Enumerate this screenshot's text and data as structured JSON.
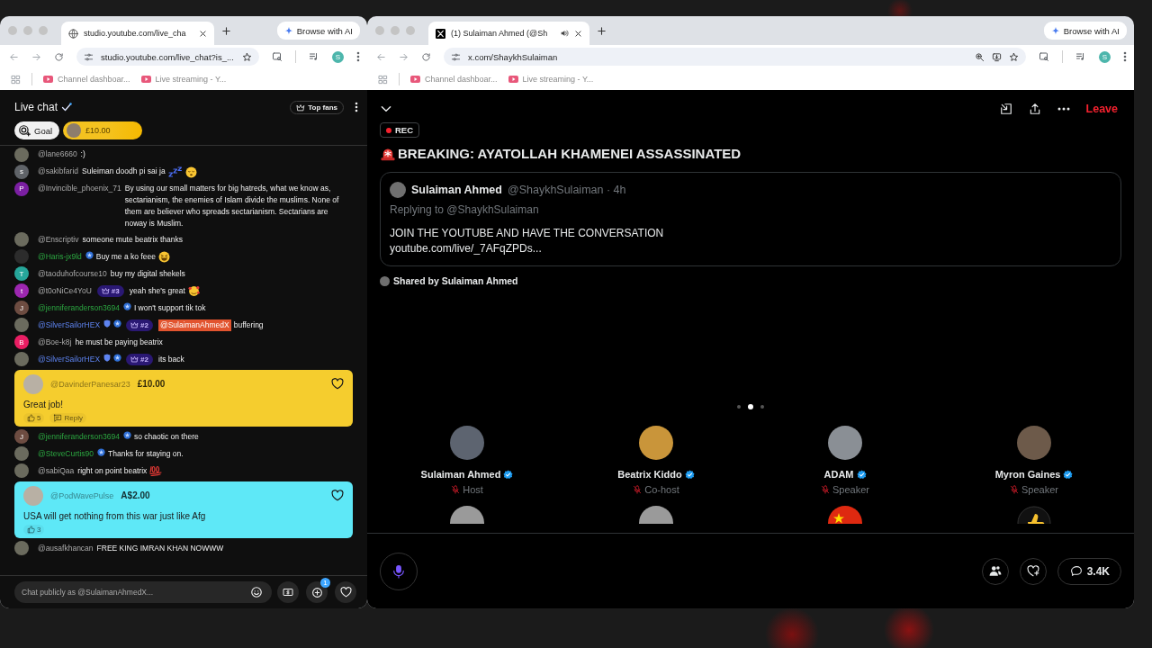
{
  "windows": [
    {
      "kind": "youtube-chat",
      "tab": {
        "icon": {
          "kind": "globe"
        },
        "title": "studio.youtube.com/live_cha"
      },
      "browse_ai": "Browse with AI",
      "address": "studio.youtube.com/live_chat?is_...",
      "profile": "S",
      "bookmarks": [
        {
          "label": "Channel dashboar..."
        },
        {
          "label": "Live streaming - Y..."
        }
      ],
      "chat": {
        "title": "Live chat",
        "top_fans": "Top fans",
        "goal": "Goal",
        "pinned_amount": "£10.00",
        "messages": [
          {
            "kind": "text",
            "avatar": {
              "kind": "photo"
            },
            "author": {
              "name": "@lane6660",
              "kind": "viewer"
            },
            "text": ":)"
          },
          {
            "kind": "text",
            "avatar": {
              "kind": "letter",
              "letter": "s",
              "color": "#5f6368"
            },
            "author": {
              "name": "@sakibfarid",
              "kind": "viewer"
            },
            "text": "Suleiman doodh pi sai ja",
            "emoji": [
              {
                "kind": "zzz"
              },
              {
                "kind": "sleeping-face"
              }
            ]
          },
          {
            "kind": "text",
            "avatar": {
              "kind": "letter",
              "letter": "P",
              "color": "#7b1fa2"
            },
            "author": {
              "name": "@Invincible_phoenix_71",
              "kind": "viewer"
            },
            "text": "By using our small matters for big hatreds, what we know as, sectarianism, the enemies of Islam divide the muslims. None of them are believer who spreads sectarianism. Sectarians are noway is Muslim."
          },
          {
            "kind": "text",
            "avatar": {
              "kind": "photo"
            },
            "author": {
              "name": "@Enscriptiv",
              "kind": "viewer"
            },
            "text": "someone mute beatrix thanks"
          },
          {
            "kind": "text",
            "avatar": {
              "kind": "blank"
            },
            "author": {
              "name": "@Haris-jx9ld",
              "kind": "member"
            },
            "badges": [
              {
                "kind": "member"
              }
            ],
            "text": "Buy me a ko feee",
            "emoji": [
              {
                "kind": "rolling-laughing"
              }
            ]
          },
          {
            "kind": "text",
            "avatar": {
              "kind": "letter",
              "letter": "T",
              "color": "#26a69a"
            },
            "author": {
              "name": "@taoduhofcourse10",
              "kind": "viewer"
            },
            "text": "buy my digital shekels"
          },
          {
            "kind": "text",
            "avatar": {
              "kind": "letter",
              "letter": "t",
              "color": "#9c27b0"
            },
            "author": {
              "name": "@t0oNiCe4YoU",
              "kind": "viewer"
            },
            "rank": "#3",
            "text": "yeah she's great",
            "emoji": [
              {
                "kind": "hearts-face"
              }
            ]
          },
          {
            "kind": "text",
            "avatar": {
              "kind": "letter",
              "letter": "J",
              "color": "#6d4c41"
            },
            "author": {
              "name": "@jenniferanderson3694",
              "kind": "member"
            },
            "badges": [
              {
                "kind": "member"
              }
            ],
            "text": "I won't support tik tok"
          },
          {
            "kind": "text",
            "avatar": {
              "kind": "photo"
            },
            "author": {
              "name": "@SilverSailorHEX",
              "kind": "moderator"
            },
            "badges": [
              {
                "kind": "moderator"
              },
              {
                "kind": "member"
              }
            ],
            "rank": "#2",
            "mention": "@SulaimanAhmedX",
            "text": "buffering"
          },
          {
            "kind": "text",
            "avatar": {
              "kind": "letter",
              "letter": "B",
              "color": "#e91e63"
            },
            "author": {
              "name": "@Boe-k8j",
              "kind": "viewer"
            },
            "text": "he must be paying beatrix"
          },
          {
            "kind": "text",
            "avatar": {
              "kind": "photo"
            },
            "author": {
              "name": "@SilverSailorHEX",
              "kind": "moderator"
            },
            "badges": [
              {
                "kind": "moderator"
              },
              {
                "kind": "member"
              }
            ],
            "rank": "#2",
            "text": "its back"
          },
          {
            "kind": "super_chat",
            "color": "#f5cd2e",
            "author": "@DavinderPanesar23",
            "amount": "£10.00",
            "text": "Great job!",
            "likes": "5",
            "reply": "Reply"
          },
          {
            "kind": "text",
            "avatar": {
              "kind": "letter",
              "letter": "J",
              "color": "#6d4c41"
            },
            "author": {
              "name": "@jenniferanderson3694",
              "kind": "member"
            },
            "badges": [
              {
                "kind": "member"
              }
            ],
            "text": "so chaotic on there"
          },
          {
            "kind": "text",
            "avatar": {
              "kind": "photo"
            },
            "author": {
              "name": "@SteveCurtis90",
              "kind": "member"
            },
            "badges": [
              {
                "kind": "member"
              }
            ],
            "text": "Thanks for staying on."
          },
          {
            "kind": "text",
            "avatar": {
              "kind": "photo"
            },
            "author": {
              "name": "@sabiQaa",
              "kind": "viewer"
            },
            "text": "right on point beatrix",
            "emoji": [
              {
                "kind": "hundred"
              }
            ]
          },
          {
            "kind": "super_chat",
            "color": "#5ee8f7",
            "author": "@PodWavePulse",
            "amount": "A$2.00",
            "text": "USA will get nothing from this war just like Afg",
            "likes": "3"
          },
          {
            "kind": "text",
            "avatar": {
              "kind": "photo"
            },
            "author": {
              "name": "@ausafkhancan",
              "kind": "viewer"
            },
            "text": "FREE KING IMRAN KHAN NOWWW"
          }
        ],
        "input": {
          "placeholder": "Chat publicly as @SulaimanAhmedX..."
        },
        "notification_count": "1"
      }
    },
    {
      "kind": "x-space",
      "tab": {
        "icon": {
          "kind": "x"
        },
        "title": "(1) Sulaiman Ahmed (@Sh",
        "audio": true
      },
      "browse_ai": "Browse with AI",
      "address": "x.com/ShaykhSulaiman",
      "profile": "S",
      "bookmarks": [
        {
          "label": "Channel dashboar..."
        },
        {
          "label": "Live streaming - Y..."
        }
      ],
      "space": {
        "leave": "Leave",
        "rec": "REC",
        "title": "BREAKING: AYATOLLAH KHAMENEI ASSASSINATED",
        "quote": {
          "name": "Sulaiman Ahmed",
          "handle": "@ShaykhSulaiman · 4h",
          "replying": "Replying to @ShaykhSulaiman",
          "text": "JOIN THE YOUTUBE AND HAVE THE CONVERSATION",
          "link": "youtube.com/live/_7AFqZPDs..."
        },
        "shared_by": "Shared by Sulaiman Ahmed",
        "pages": [
          {
            "selected": false
          },
          {
            "selected": true
          },
          {
            "selected": false
          }
        ],
        "speakers": [
          {
            "name": "Sulaiman Ahmed",
            "verified": true,
            "muted": true,
            "role": "Host"
          },
          {
            "name": "Beatrix Kiddo",
            "verified": true,
            "muted": true,
            "role": "Co-host"
          },
          {
            "name": "ADAM",
            "verified": true,
            "muted": true,
            "role": "Speaker"
          },
          {
            "name": "Myron Gaines",
            "verified": true,
            "muted": true,
            "role": "Speaker"
          }
        ],
        "next_row": [
          {
            "kind": "photo"
          },
          {
            "kind": "photo"
          },
          {
            "kind": "flag"
          },
          {
            "kind": "thumbs-up"
          }
        ],
        "comments": "3.4K"
      }
    }
  ]
}
